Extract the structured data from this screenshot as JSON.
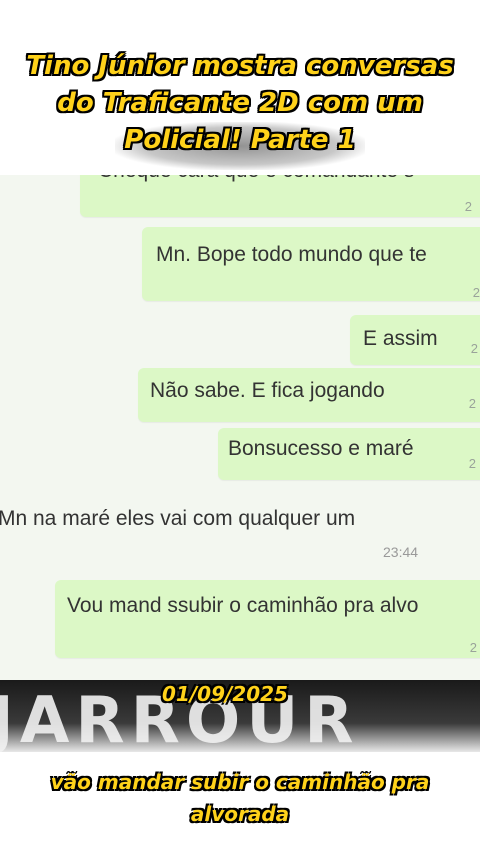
{
  "video_title": "Tino Júnior mostra conversas do Traficante 2D com um Policial! Parte 1",
  "chat": {
    "partial_top_message": "Cheque cara que é comandante s",
    "messages": [
      {
        "text": "Mn. Bope todo mundo que te",
        "time": "2"
      },
      {
        "text": "E assim",
        "time": "2"
      },
      {
        "text": "Não sabe. E fica jogando",
        "time": "2"
      },
      {
        "text": "Bonsucesso e maré",
        "time": "2"
      },
      {
        "text": "Mn na maré eles vai com qualquer um",
        "time": "23:44"
      },
      {
        "text": "Vou mand ssubir o caminhão pra alvo",
        "time": "2"
      }
    ],
    "top_time": "2"
  },
  "band_text": "JARROUR",
  "date_label": "01/09/2025",
  "subtitle": "vão mandar subir o caminhão pra alvorada",
  "colors": {
    "caption_yellow": "#ffd21a",
    "bubble_green": "#dcf8c6",
    "chat_bg": "#f3f7f0"
  }
}
